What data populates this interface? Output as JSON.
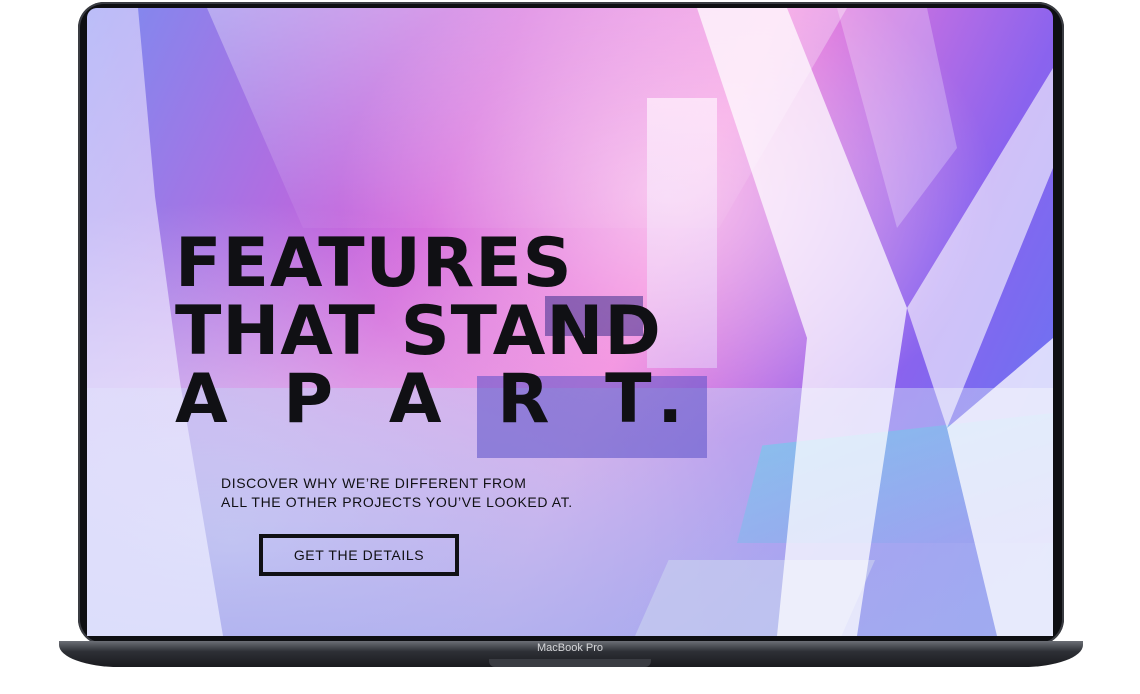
{
  "hero": {
    "title_lines": [
      "FEATURES",
      "THAT STAND",
      "A P A R T."
    ],
    "subtitle_lines": [
      "DISCOVER WHY WE’RE DIFFERENT FROM",
      "ALL THE OTHER PROJECTS YOU’VE LOOKED AT."
    ],
    "cta_label": "GET THE DETAILS"
  },
  "device": {
    "label": "MacBook Pro"
  },
  "colors": {
    "pink": "#f27ad9",
    "magenta": "#d15ad8",
    "violet": "#8a63ee",
    "blue": "#5b7cf4",
    "text": "#101014"
  }
}
